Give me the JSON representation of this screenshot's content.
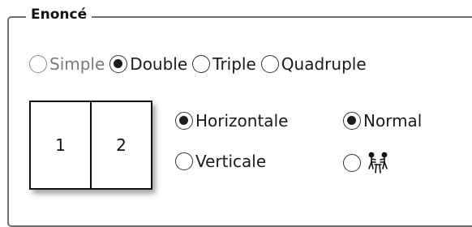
{
  "group": {
    "title": "Enoncé"
  },
  "type_options": [
    {
      "label": "Simple",
      "checked": false,
      "dim": true
    },
    {
      "label": "Double",
      "checked": true,
      "dim": false
    },
    {
      "label": "Triple",
      "checked": false,
      "dim": false
    },
    {
      "label": "Quadruple",
      "checked": false,
      "dim": false
    }
  ],
  "preview": {
    "cells": [
      "1",
      "2"
    ]
  },
  "orientation": {
    "horizontal_label": "Horizontale",
    "vertical_label": "Verticale",
    "selected": "Horizontale"
  },
  "mode": {
    "normal_label": "Normal",
    "selected": "Normal",
    "alt_icon": "people-facing-table-icon"
  }
}
